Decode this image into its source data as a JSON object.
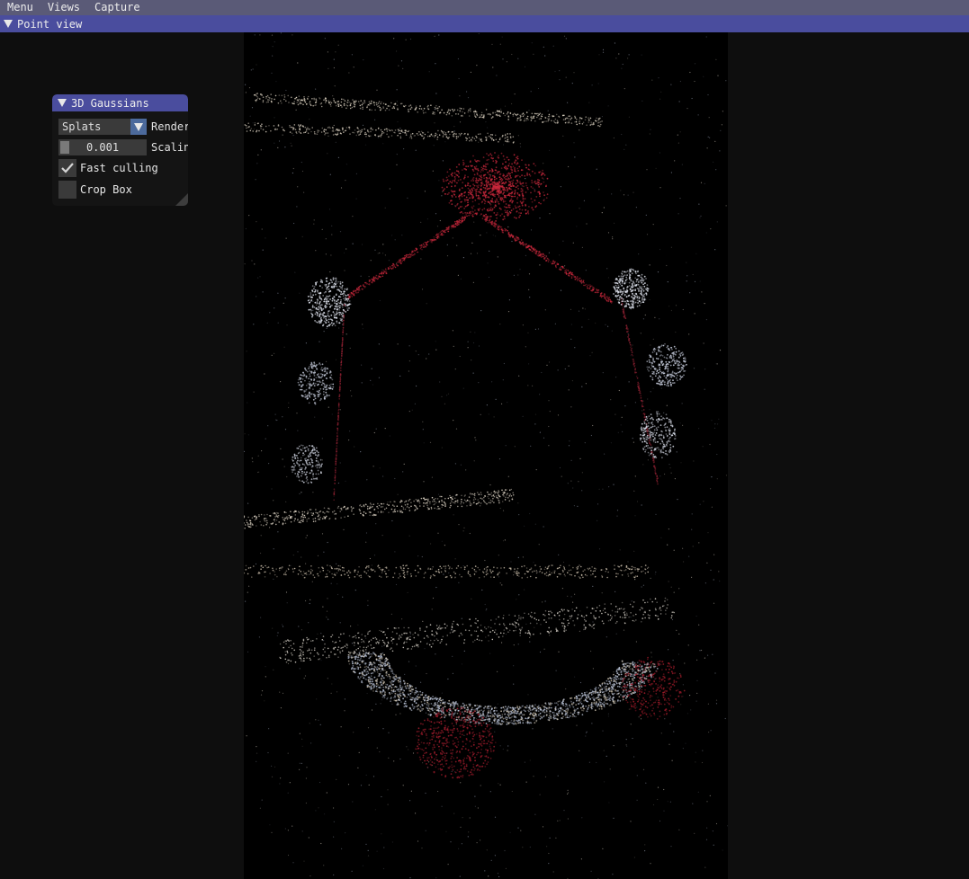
{
  "menubar": {
    "items": [
      "Menu",
      "Views",
      "Capture"
    ]
  },
  "point_view": {
    "title": "Point view"
  },
  "gaussians_window": {
    "title": "3D Gaussians",
    "render_mode": {
      "value": "Splats",
      "label": "Render"
    },
    "scaling": {
      "value": "0.001",
      "label": "Scaling"
    },
    "fast_culling": {
      "label": "Fast culling",
      "checked": true
    },
    "crop_box": {
      "label": "Crop Box",
      "checked": false
    }
  },
  "colors": {
    "menubar_bg": "#5a5a77",
    "header_bg": "#4a4d9e",
    "frame_bg": "#3a3a3a",
    "accent": "#4c6a9c",
    "splat_red": "#c8283c",
    "splat_light": "#d8d8e0"
  },
  "icons": {
    "collapse_arrow": "triangle-down-icon",
    "combo_arrow": "chevron-down-icon",
    "check": "checkmark-icon"
  }
}
